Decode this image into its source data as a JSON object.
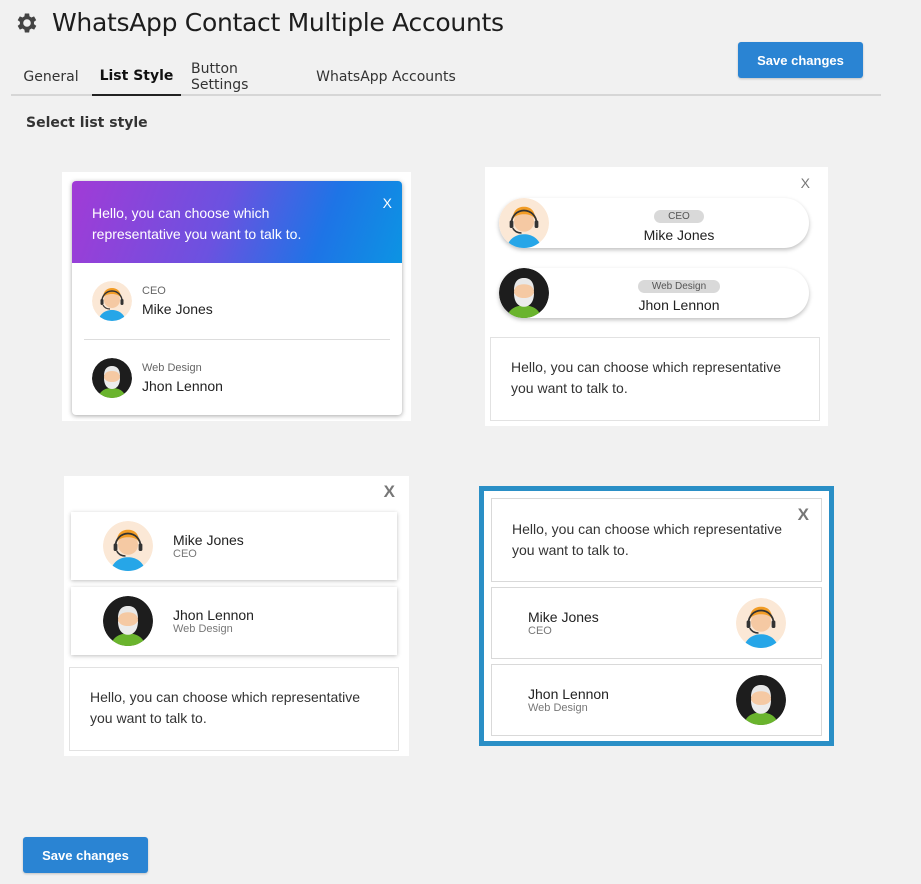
{
  "header": {
    "title": "WhatsApp Contact Multiple Accounts",
    "save_label": "Save changes"
  },
  "tabs": [
    {
      "label": "General"
    },
    {
      "label": "List Style"
    },
    {
      "label": "Button Settings"
    },
    {
      "label": "WhatsApp Accounts"
    }
  ],
  "active_tab": "List Style",
  "section": {
    "label": "Select list style"
  },
  "preview": {
    "message": "Hello, you can choose which representative you want to talk to.",
    "close": "X",
    "contacts": [
      {
        "name": "Mike Jones",
        "role": "CEO",
        "avatar": "support-agent-avatar"
      },
      {
        "name": "Jhon Lennon",
        "role": "Web Design",
        "avatar": "bearded-man-avatar"
      }
    ]
  },
  "selected_style": 4,
  "footer": {
    "save_label": "Save changes"
  },
  "colors": {
    "accent": "#2a84d3",
    "selected_border": "#2a8fc6",
    "gradient_start": "#a13bd6",
    "gradient_end": "#0c94e3"
  }
}
